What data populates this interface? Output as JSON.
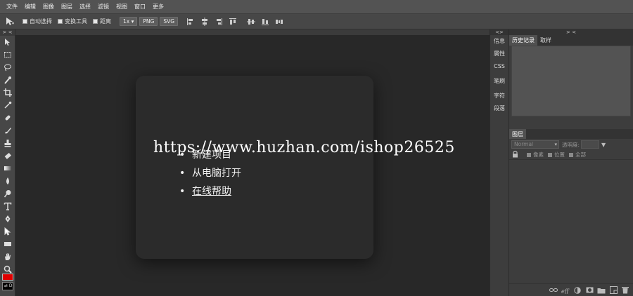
{
  "menu": {
    "items": [
      "文件",
      "编辑",
      "图像",
      "图层",
      "选择",
      "滤镜",
      "视图",
      "窗口",
      "更多"
    ]
  },
  "options": {
    "auto_select": "自动选择",
    "transform_tools": "变换工具",
    "distance": "距离",
    "zoom": "1x ▾",
    "png": "PNG",
    "svg": "SVG"
  },
  "collapse": {
    "toolbar": "> <",
    "minicol": "<>",
    "rpanel": "> <"
  },
  "minicol": {
    "items": [
      "信息",
      "属性",
      "CSS",
      "笔刷",
      "字符",
      "段落"
    ]
  },
  "history": {
    "tabs": [
      "历史记录",
      "取样"
    ]
  },
  "layers": {
    "tab": "图层",
    "blend_mode": "Normal",
    "opacity_label": "透明度:",
    "lock_pixels": "像素",
    "lock_position": "位置",
    "lock_all": "全部"
  },
  "swatches": {
    "foreground_color": "#e00000",
    "background_color": "#000000"
  },
  "dialog": {
    "items": [
      "新建项目",
      "从电脑打开",
      "在线帮助"
    ]
  },
  "watermark": "https://www.huzhan.com/ishop26525"
}
